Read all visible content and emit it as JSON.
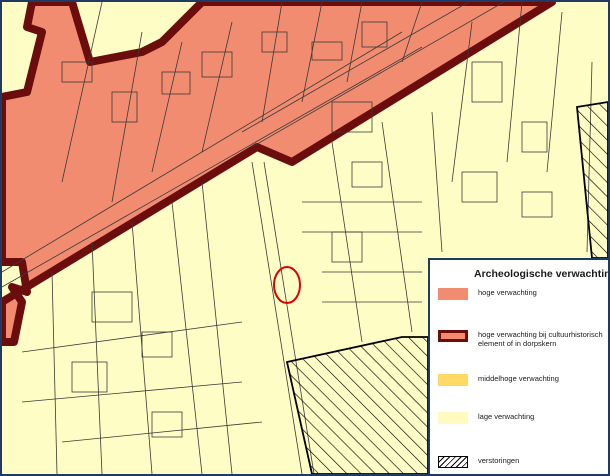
{
  "legend": {
    "title": "Archeologische verwachting",
    "items": [
      {
        "label": "hoge verwachting",
        "fill": "#f28c70",
        "border": "#f28c70",
        "pattern": "solid"
      },
      {
        "label": "hoge verwachting bij cultuurhistorisch element of in dorpskern",
        "fill": "#f28c70",
        "border": "#6b0d0d",
        "pattern": "solid-thick-border"
      },
      {
        "label": "middelhoge verwachting",
        "fill": "#ffd966",
        "border": "#ffd966",
        "pattern": "solid"
      },
      {
        "label": "lage verwachting",
        "fill": "#fffbbf",
        "border": "#fffbbf",
        "pattern": "solid"
      },
      {
        "label": "verstoringen",
        "fill": "#ffffff",
        "border": "#000000",
        "pattern": "hatched"
      }
    ]
  },
  "map": {
    "low_zone_color": "#fefdc6",
    "high_zone_color": "#f28c70",
    "high_zone_border_color": "#6b0d0d",
    "marker_color": "#e00000"
  }
}
